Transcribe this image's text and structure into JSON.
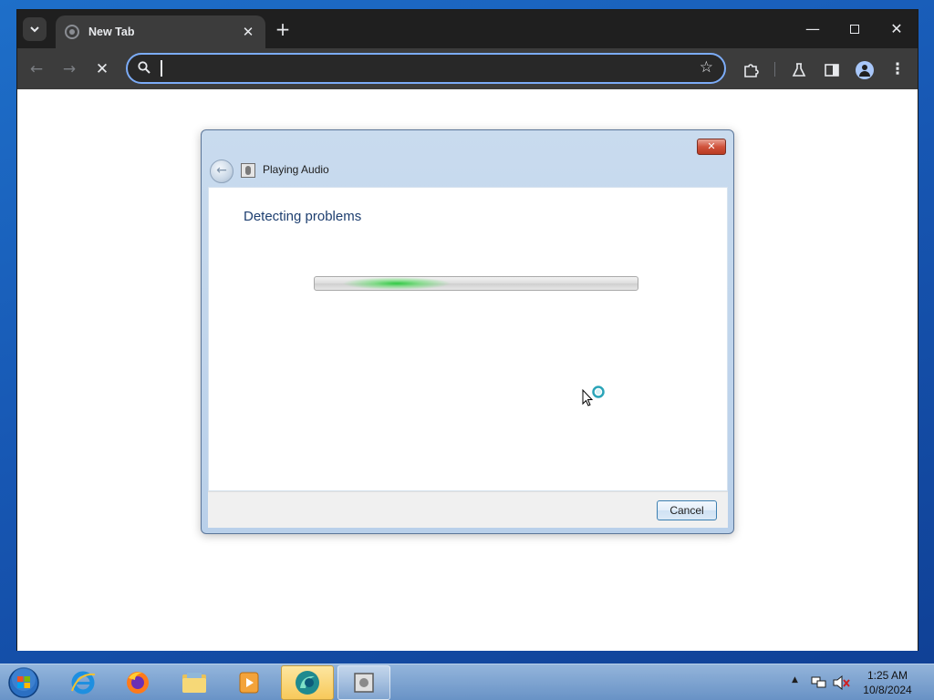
{
  "browser": {
    "tab_title": "New Tab",
    "tab_close": "✕",
    "new_tab": "+",
    "window_controls": {
      "minimize": "—",
      "close": "✕"
    },
    "nav": {
      "back": "←",
      "forward": "→",
      "stop": "✕"
    },
    "omnibox": {
      "value": "",
      "placeholder": ""
    },
    "menu": "⋮"
  },
  "dialog": {
    "title": "Playing Audio",
    "close": "✕",
    "back": "←",
    "heading": "Detecting problems",
    "cancel_label": "Cancel"
  },
  "taskbar": {
    "items": [
      "start",
      "internet-explorer",
      "firefox",
      "file-explorer",
      "media-player",
      "browser",
      "troubleshooter"
    ],
    "clock": {
      "time": "1:25 AM",
      "date": "10/8/2024"
    },
    "tray_arrow": "▲"
  },
  "colors": {
    "desktop": "#1757b3",
    "omnibox_border": "#7cacf8",
    "dialog_heading": "#1e3f70",
    "progress_glow": "#28c83c",
    "close_button": "#d0533c"
  }
}
